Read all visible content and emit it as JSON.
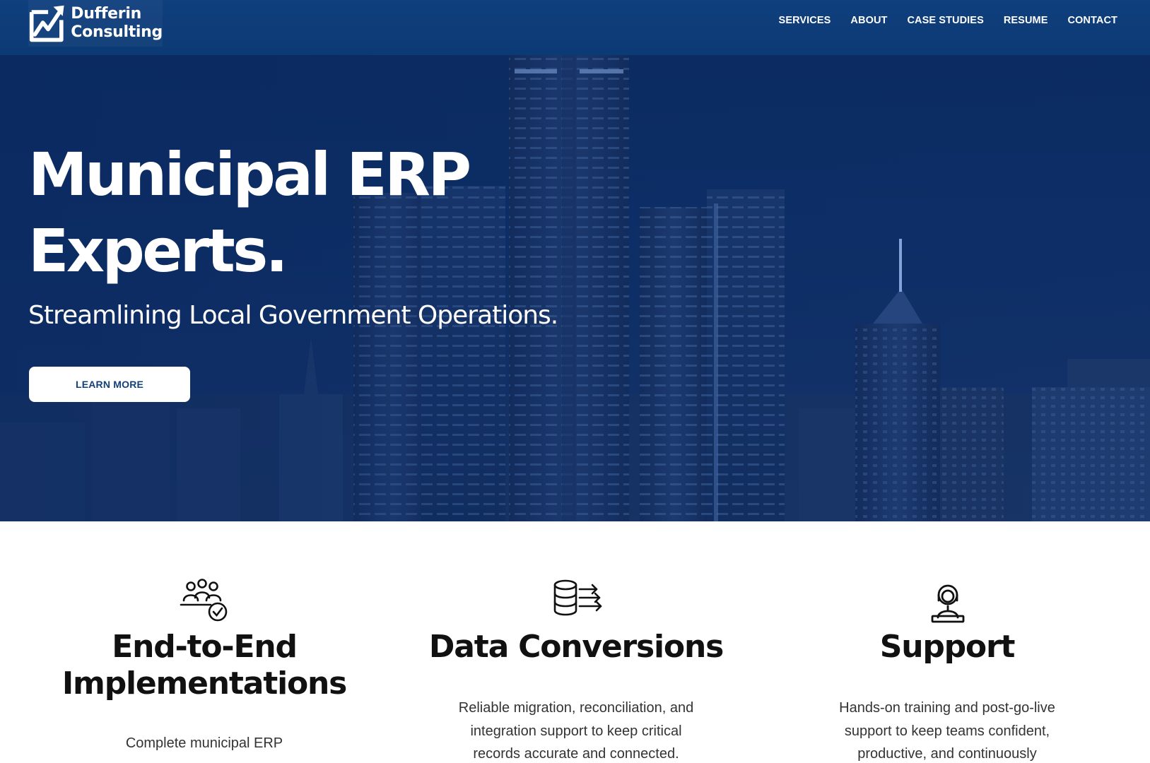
{
  "brand": {
    "name_line1": "Dufferin",
    "name_line2": "Consulting",
    "logo_icon": "chart-arrow-icon",
    "accent_color": "#0f3f7d"
  },
  "nav": {
    "items": [
      {
        "label": "SERVICES"
      },
      {
        "label": "ABOUT"
      },
      {
        "label": "CASE STUDIES"
      },
      {
        "label": "RESUME"
      },
      {
        "label": "CONTACT"
      }
    ]
  },
  "hero": {
    "title_line1": "Municipal ERP",
    "title_line2": "Experts.",
    "subtitle": "Streamlining Local Government Operations.",
    "cta_label": "LEARN MORE",
    "background": "night city skyline"
  },
  "services": [
    {
      "icon": "team-check-icon",
      "title_line1": "End-to-End",
      "title_line2": "Implementations",
      "desc_lines": [
        "Complete municipal ERP"
      ]
    },
    {
      "icon": "database-transfer-icon",
      "title_line1": "Data Conversions",
      "desc_lines": [
        "Reliable migration, reconciliation, and",
        "integration support to keep critical",
        "records accurate and connected."
      ]
    },
    {
      "icon": "support-agent-icon",
      "title_line1": "Support",
      "desc_lines": [
        "Hands-on training and post-go-live",
        "support to keep teams confident,",
        "productive, and continuously"
      ]
    }
  ]
}
